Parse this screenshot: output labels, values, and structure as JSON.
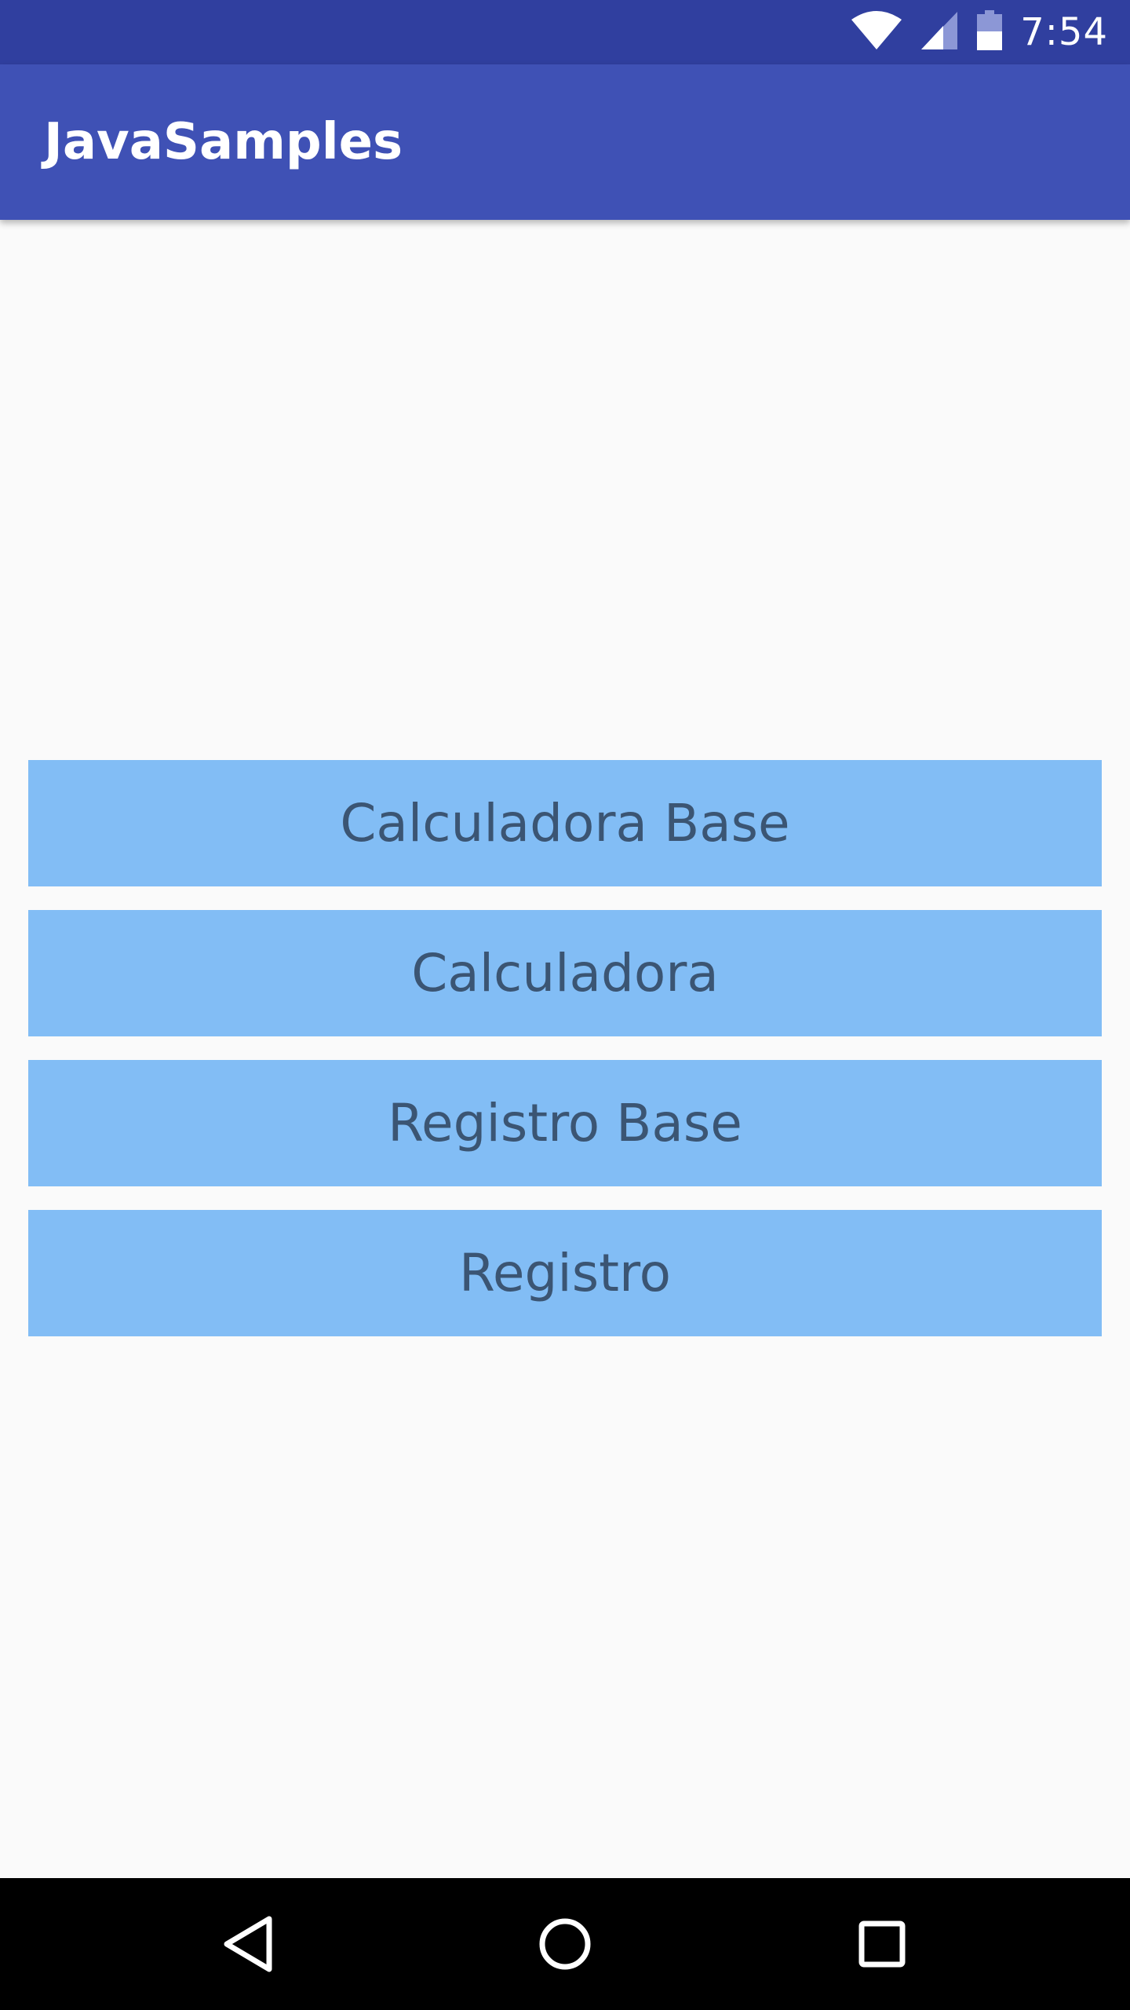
{
  "status_bar": {
    "time": "7:54",
    "icons": [
      "wifi-icon",
      "cell-signal-icon",
      "battery-icon"
    ],
    "background": "#303f9f"
  },
  "app_bar": {
    "title": "JavaSamples",
    "background": "#3f51b5"
  },
  "menu": {
    "button_color": "#82bdf5",
    "text_color": "#3b5573",
    "items": [
      {
        "label": "Calculadora Base"
      },
      {
        "label": "Calculadora"
      },
      {
        "label": "Registro Base"
      },
      {
        "label": "Registro"
      }
    ]
  },
  "nav_bar": {
    "icons": [
      "back-icon",
      "home-icon",
      "recents-icon"
    ]
  }
}
